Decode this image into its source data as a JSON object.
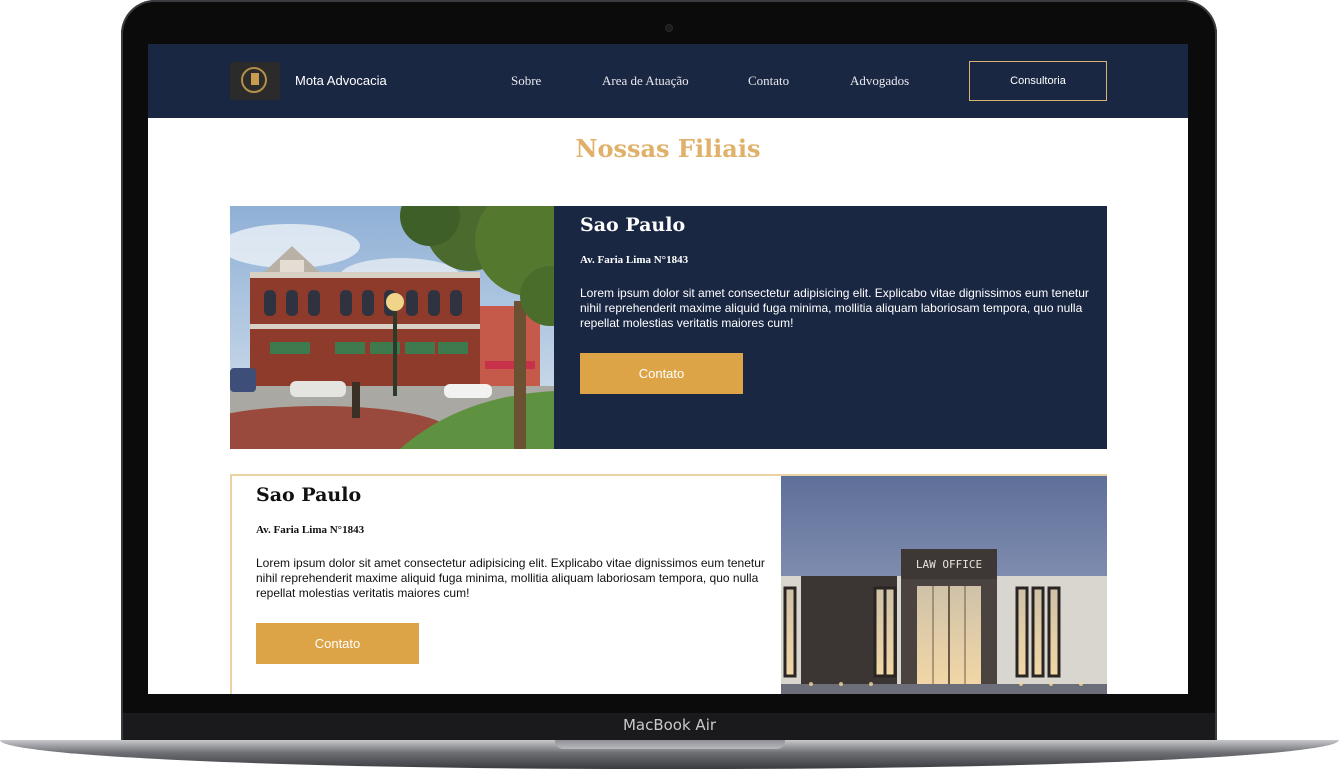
{
  "device": {
    "label": "MacBook Air"
  },
  "navbar": {
    "brand": "Mota Advocacia",
    "links": [
      "Sobre",
      "Area de Atuação",
      "Contato",
      "Advogados"
    ],
    "cta_label": "Consultoria"
  },
  "page": {
    "title": "Nossas Filiais"
  },
  "branches": [
    {
      "city": "Sao Paulo",
      "address": "Av. Faria Lima N°1843",
      "description": "Lorem ipsum dolor sit amet consectetur adipisicing elit. Explicabo vitae dignissimos eum tenetur nihil reprehenderit maxime aliquid fuga minima, mollitia aliquam laboriosam tempora, quo nulla repellat molestias veritatis maiores cum!",
      "button_label": "Contato"
    },
    {
      "city": "Sao Paulo",
      "address": "Av. Faria Lima N°1843",
      "description": "Lorem ipsum dolor sit amet consectetur adipisicing elit. Explicabo vitae dignissimos eum tenetur nihil reprehenderit maxime aliquid fuga minima, mollitia aliquam laboriosam tempora, quo nulla repellat molestias veritatis maiores cum!",
      "button_label": "Contato",
      "photo_sign": "LAW OFFICE"
    }
  ],
  "colors": {
    "navy": "#1a2743",
    "gold": "#dca447",
    "title_gold": "#e0b16b",
    "border_gold": "#ead3a0"
  }
}
